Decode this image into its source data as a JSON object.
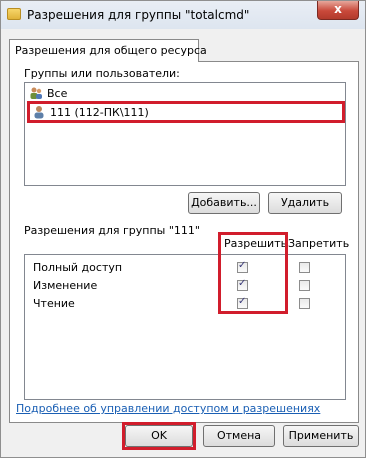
{
  "window": {
    "title": "Разрешения для группы \"totalcmd\"",
    "close_label": "x"
  },
  "tab": {
    "label": "Разрешения для общего ресурса"
  },
  "users_section": {
    "label": "Группы или пользователи:",
    "items": [
      {
        "label": "Все",
        "icon": "group-icon"
      },
      {
        "label": "111 (112-ПК\\111)",
        "icon": "user-icon",
        "selected": true
      }
    ]
  },
  "buttons": {
    "add": "Добавить...",
    "remove": "Удалить",
    "ok": "OK",
    "cancel": "Отмена",
    "apply": "Применить"
  },
  "perm_section": {
    "label": "Разрешения для группы \"111\"",
    "col_allow": "Разрешить",
    "col_deny": "Запретить",
    "rows": [
      {
        "label": "Полный доступ",
        "allow": true,
        "deny": false
      },
      {
        "label": "Изменение",
        "allow": true,
        "deny": false
      },
      {
        "label": "Чтение",
        "allow": true,
        "deny": false
      }
    ]
  },
  "link": {
    "text": "Подробнее об управлении доступом и разрешениях"
  },
  "colors": {
    "highlight": "#d11d2c",
    "link": "#1a5fb4"
  }
}
